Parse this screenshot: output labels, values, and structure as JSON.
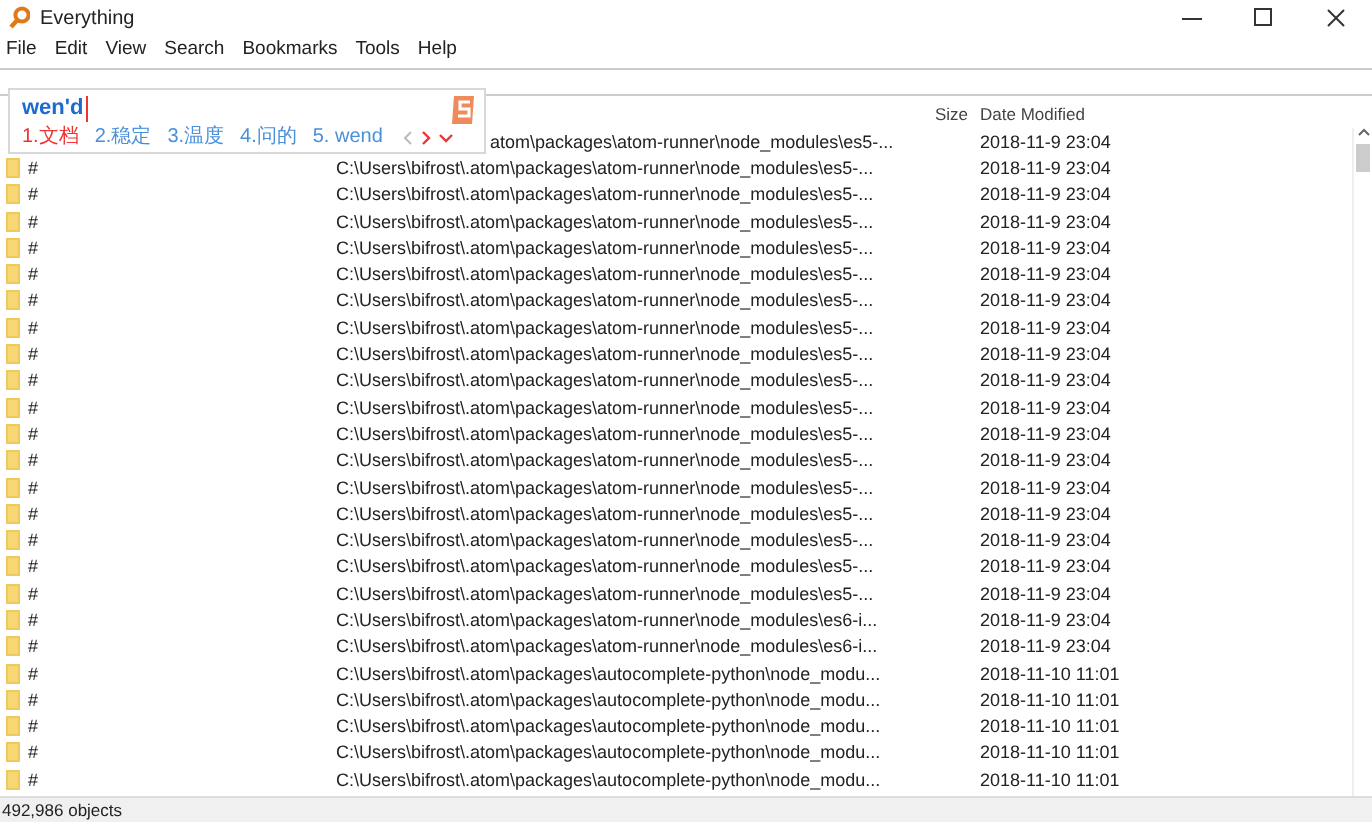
{
  "window": {
    "title": "Everything"
  },
  "menu": [
    "File",
    "Edit",
    "View",
    "Search",
    "Bookmarks",
    "Tools",
    "Help"
  ],
  "ime": {
    "composition": "wen'd",
    "candidates": [
      {
        "label": "1.文档",
        "selected": true
      },
      {
        "label": "2.稳定",
        "selected": false
      },
      {
        "label": "3.温度",
        "selected": false
      },
      {
        "label": "4.问的",
        "selected": false
      },
      {
        "label": "5. wend",
        "selected": false
      }
    ]
  },
  "table": {
    "columns": [
      "Size",
      "Date Modified"
    ],
    "rows": [
      {
        "path": "atom\\packages\\atom-runner\\node_modules\\es5-...",
        "date": "2018-11-9 23:04"
      },
      {
        "name": "#",
        "path": "C:\\Users\\bifrost\\.atom\\packages\\atom-runner\\node_modules\\es5-...",
        "date": "2018-11-9 23:04"
      },
      {
        "name": "#",
        "path": "C:\\Users\\bifrost\\.atom\\packages\\atom-runner\\node_modules\\es5-...",
        "date": "2018-11-9 23:04"
      },
      {
        "name": "#",
        "path": "C:\\Users\\bifrost\\.atom\\packages\\atom-runner\\node_modules\\es5-...",
        "date": "2018-11-9 23:04"
      },
      {
        "name": "#",
        "path": "C:\\Users\\bifrost\\.atom\\packages\\atom-runner\\node_modules\\es5-...",
        "date": "2018-11-9 23:04"
      },
      {
        "name": "#",
        "path": "C:\\Users\\bifrost\\.atom\\packages\\atom-runner\\node_modules\\es5-...",
        "date": "2018-11-9 23:04"
      },
      {
        "name": "#",
        "path": "C:\\Users\\bifrost\\.atom\\packages\\atom-runner\\node_modules\\es5-...",
        "date": "2018-11-9 23:04"
      },
      {
        "name": "#",
        "path": "C:\\Users\\bifrost\\.atom\\packages\\atom-runner\\node_modules\\es5-...",
        "date": "2018-11-9 23:04"
      },
      {
        "name": "#",
        "path": "C:\\Users\\bifrost\\.atom\\packages\\atom-runner\\node_modules\\es5-...",
        "date": "2018-11-9 23:04"
      },
      {
        "name": "#",
        "path": "C:\\Users\\bifrost\\.atom\\packages\\atom-runner\\node_modules\\es5-...",
        "date": "2018-11-9 23:04"
      },
      {
        "name": "#",
        "path": "C:\\Users\\bifrost\\.atom\\packages\\atom-runner\\node_modules\\es5-...",
        "date": "2018-11-9 23:04"
      },
      {
        "name": "#",
        "path": "C:\\Users\\bifrost\\.atom\\packages\\atom-runner\\node_modules\\es5-...",
        "date": "2018-11-9 23:04"
      },
      {
        "name": "#",
        "path": "C:\\Users\\bifrost\\.atom\\packages\\atom-runner\\node_modules\\es5-...",
        "date": "2018-11-9 23:04"
      },
      {
        "name": "#",
        "path": "C:\\Users\\bifrost\\.atom\\packages\\atom-runner\\node_modules\\es5-...",
        "date": "2018-11-9 23:04"
      },
      {
        "name": "#",
        "path": "C:\\Users\\bifrost\\.atom\\packages\\atom-runner\\node_modules\\es5-...",
        "date": "2018-11-9 23:04"
      },
      {
        "name": "#",
        "path": "C:\\Users\\bifrost\\.atom\\packages\\atom-runner\\node_modules\\es5-...",
        "date": "2018-11-9 23:04"
      },
      {
        "name": "#",
        "path": "C:\\Users\\bifrost\\.atom\\packages\\atom-runner\\node_modules\\es5-...",
        "date": "2018-11-9 23:04"
      },
      {
        "name": "#",
        "path": "C:\\Users\\bifrost\\.atom\\packages\\atom-runner\\node_modules\\es5-...",
        "date": "2018-11-9 23:04"
      },
      {
        "name": "#",
        "path": "C:\\Users\\bifrost\\.atom\\packages\\atom-runner\\node_modules\\es6-i...",
        "date": "2018-11-9 23:04"
      },
      {
        "name": "#",
        "path": "C:\\Users\\bifrost\\.atom\\packages\\atom-runner\\node_modules\\es6-i...",
        "date": "2018-11-9 23:04"
      },
      {
        "name": "#",
        "path": "C:\\Users\\bifrost\\.atom\\packages\\autocomplete-python\\node_modu...",
        "date": "2018-11-10 11:01"
      },
      {
        "name": "#",
        "path": "C:\\Users\\bifrost\\.atom\\packages\\autocomplete-python\\node_modu...",
        "date": "2018-11-10 11:01"
      },
      {
        "name": "#",
        "path": "C:\\Users\\bifrost\\.atom\\packages\\autocomplete-python\\node_modu...",
        "date": "2018-11-10 11:01"
      },
      {
        "name": "#",
        "path": "C:\\Users\\bifrost\\.atom\\packages\\autocomplete-python\\node_modu...",
        "date": "2018-11-10 11:01"
      },
      {
        "name": "#",
        "path": "C:\\Users\\bifrost\\.atom\\packages\\autocomplete-python\\node_modu...",
        "date": "2018-11-10 11:01"
      }
    ]
  },
  "status_bar": "492,986 objects"
}
